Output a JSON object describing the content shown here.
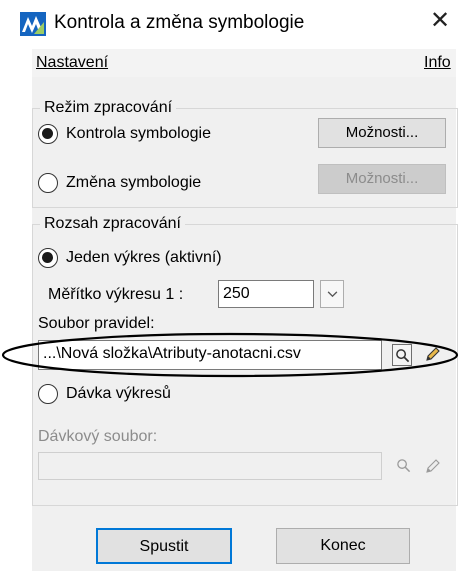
{
  "window": {
    "title": "Kontrola a změna symbologie",
    "close_glyph": "✕"
  },
  "menu": {
    "left_label": "Nastavení",
    "right_label": "Info"
  },
  "mode_group": {
    "legend": "Režim zpracování",
    "option_check": {
      "label": "Kontrola symbologie",
      "selected": true,
      "button_label": "Možnosti..."
    },
    "option_change": {
      "label": "Změna symbologie",
      "selected": false,
      "button_label": "Možnosti..."
    }
  },
  "range_group": {
    "legend": "Rozsah zpracování",
    "option_single": {
      "label": "Jeden výkres (aktivní)",
      "selected": true
    },
    "scale_label": "Měřítko výkresu 1 :",
    "scale_value": "250",
    "rules_label": "Soubor pravidel:",
    "rules_value": "...\\Nová složka\\Atributy-anotacni.csv",
    "option_batch": {
      "label": "Dávka výkresů",
      "selected": false
    },
    "batch_file_label": "Dávkový soubor:",
    "batch_file_value": ""
  },
  "footer": {
    "run_label": "Spustit",
    "end_label": "Konec"
  },
  "icons": {
    "app": "microstation-logo-icon",
    "close": "close-icon",
    "dropdown": "chevron-down-icon",
    "browse": "magnifier-icon",
    "edit": "pencil-icon"
  }
}
